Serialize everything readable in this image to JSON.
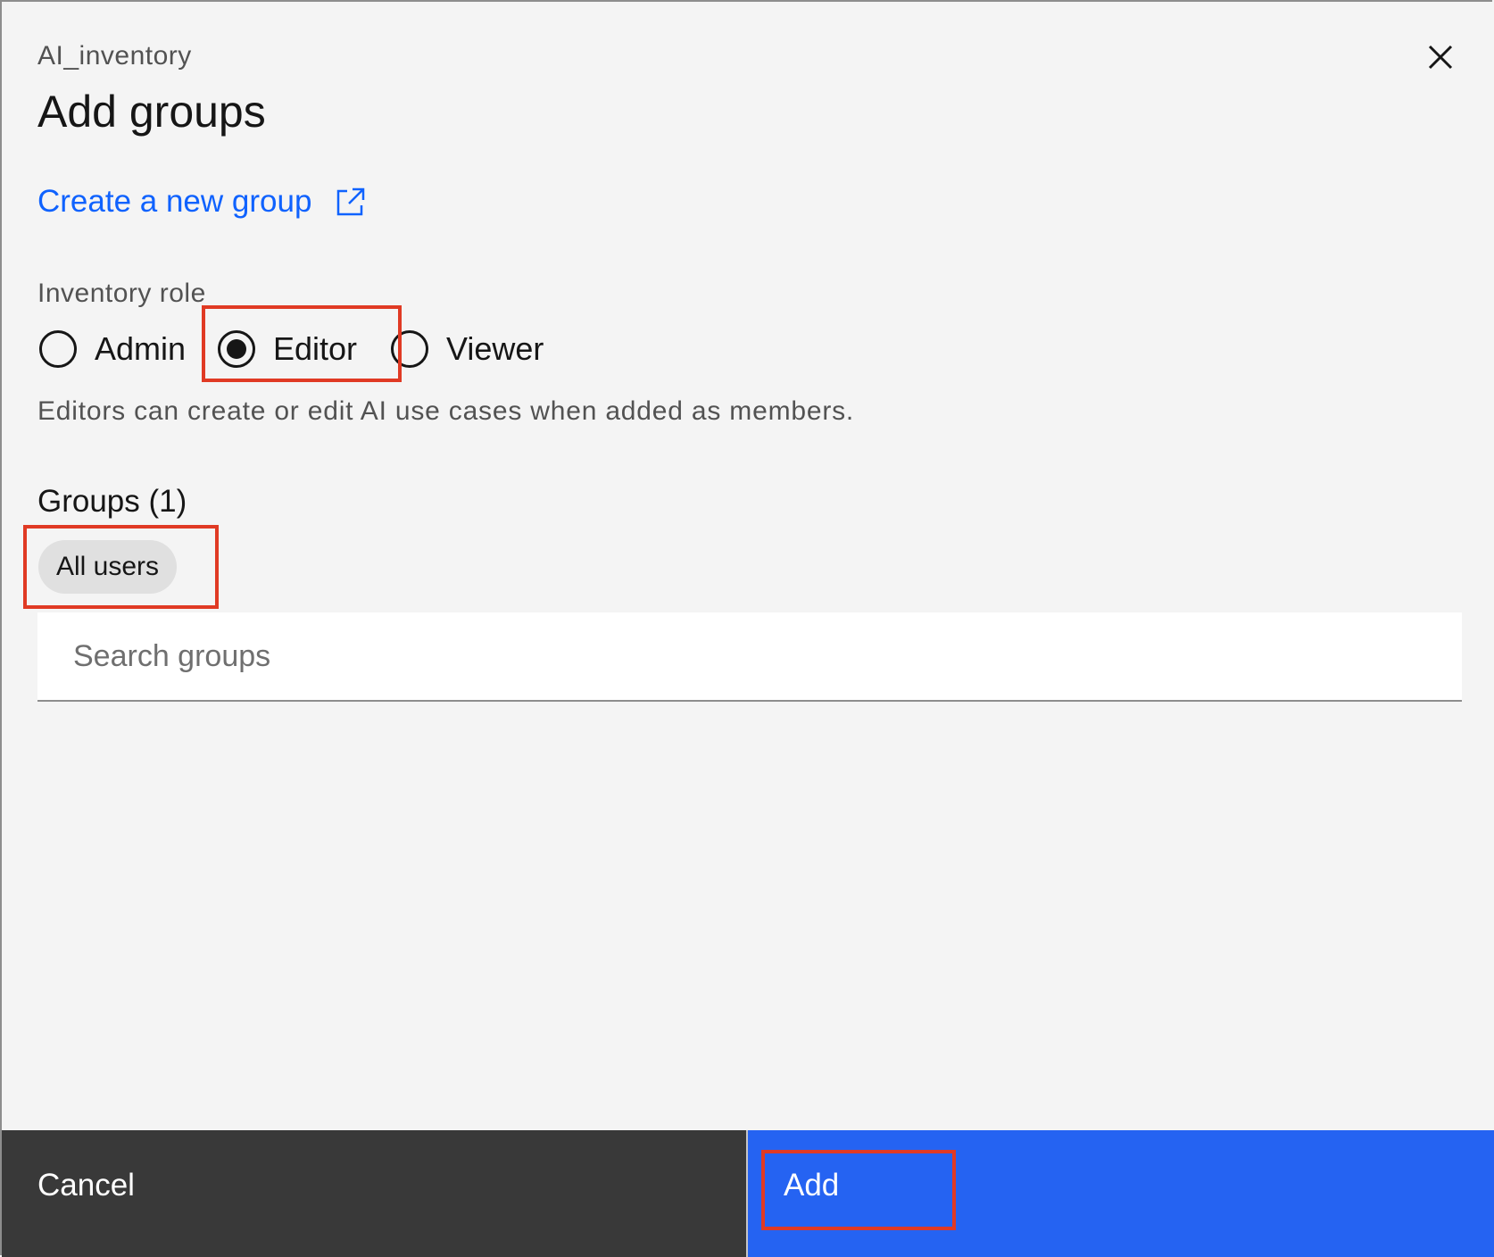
{
  "modal": {
    "eyebrow": "AI_inventory",
    "title": "Add groups",
    "close_icon": "close-icon"
  },
  "create_link": {
    "label": "Create a new group",
    "icon": "launch-icon",
    "color": "#0f62fe"
  },
  "role": {
    "label": "Inventory role",
    "options": [
      {
        "label": "Admin",
        "selected": false
      },
      {
        "label": "Editor",
        "selected": true
      },
      {
        "label": "Viewer",
        "selected": false
      }
    ],
    "helper": "Editors can create or edit AI use cases when added as members."
  },
  "groups": {
    "heading": "Groups (1)",
    "tags": [
      "All users"
    ]
  },
  "search": {
    "placeholder": "Search groups",
    "value": ""
  },
  "footer": {
    "cancel_label": "Cancel",
    "add_label": "Add",
    "primary_color": "#2563f2",
    "secondary_color": "#393939"
  },
  "highlight_color": "#e03a24"
}
